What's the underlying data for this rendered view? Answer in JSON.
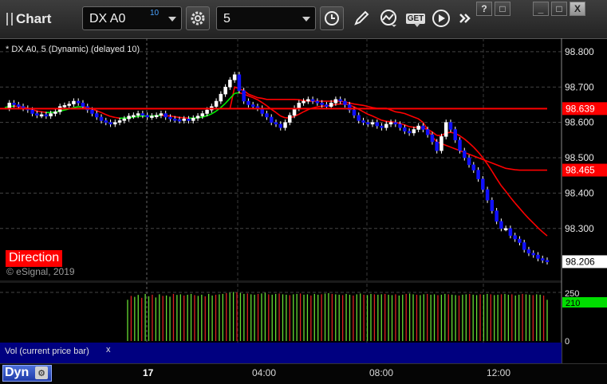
{
  "toolbar": {
    "title": "Chart",
    "symbol": "DX A0",
    "symbol_badge": "10",
    "interval": "5",
    "get_label": "GET",
    "window_buttons": [
      "?",
      "□",
      "_",
      "□",
      "X"
    ]
  },
  "chart": {
    "study_label": "* DX A0, 5 (Dynamic) (delayed 10)",
    "direction_label": "Direction",
    "copyright": "© eSignal, 2019",
    "volume_label": "Vol (current price bar)",
    "volume_close": "x",
    "dyn_label": "Dyn",
    "colors": {
      "background": "#000000",
      "candle_up": "#ffffff",
      "candle_down": "#1010ff",
      "ma_red": "#ff0000",
      "ma_green": "#00ee00",
      "vol_up": "#66dd33",
      "vol_down": "#dd2222",
      "price_marker": "#ff0000",
      "volume_marker": "#00dd00",
      "volume_panel": "#000080"
    }
  },
  "chart_data": {
    "type": "line",
    "price_axis_ticks": [
      "98.800",
      "98.700",
      "98.600",
      "98.500",
      "98.400",
      "98.300"
    ],
    "price_ylim": [
      98.18,
      98.82
    ],
    "time_ticks": [
      "17",
      "04:00",
      "08:00",
      "12:00"
    ],
    "price_markers": [
      "98.639",
      "98.465",
      "98.206"
    ],
    "volume_ticks": [
      "250",
      "0"
    ],
    "volume_marker": "210",
    "price_series": [
      98.64,
      98.655,
      98.65,
      98.645,
      98.64,
      98.635,
      98.625,
      98.62,
      98.622,
      98.618,
      98.625,
      98.63,
      98.645,
      98.648,
      98.652,
      98.66,
      98.655,
      98.645,
      98.635,
      98.625,
      98.615,
      98.605,
      98.6,
      98.595,
      98.6,
      98.605,
      98.61,
      98.618,
      98.62,
      98.625,
      98.62,
      98.615,
      98.618,
      98.62,
      98.625,
      98.615,
      98.61,
      98.608,
      98.605,
      98.61,
      98.605,
      98.612,
      98.618,
      98.625,
      98.635,
      98.645,
      98.66,
      98.68,
      98.7,
      98.72,
      98.735,
      98.69,
      98.66,
      98.65,
      98.645,
      98.64,
      98.625,
      98.615,
      98.6,
      98.595,
      98.585,
      98.6,
      98.62,
      98.64,
      98.655,
      98.66,
      98.665,
      98.66,
      98.655,
      98.65,
      98.645,
      98.655,
      98.665,
      98.66,
      98.65,
      98.635,
      98.62,
      98.605,
      98.6,
      98.595,
      98.6,
      98.59,
      98.585,
      98.595,
      98.6,
      98.595,
      98.585,
      98.575,
      98.57,
      98.58,
      98.59,
      98.58,
      98.565,
      98.545,
      98.52,
      98.56,
      98.6,
      98.58,
      98.55,
      98.52,
      98.5,
      98.48,
      98.465,
      98.44,
      98.41,
      98.38,
      98.35,
      98.32,
      98.3,
      98.3,
      98.28,
      98.27,
      98.26,
      98.24,
      98.23,
      98.225,
      98.215,
      98.21,
      98.206
    ],
    "ma_short": [
      98.642,
      98.645,
      98.646,
      98.645,
      98.643,
      98.64,
      98.636,
      98.632,
      98.63,
      98.628,
      98.628,
      98.629,
      98.632,
      98.635,
      98.638,
      98.642,
      98.644,
      98.644,
      98.642,
      98.638,
      98.633,
      98.628,
      98.622,
      98.617,
      98.614,
      98.612,
      98.612,
      98.613,
      98.615,
      98.617,
      98.618,
      98.618,
      98.618,
      98.619,
      98.62,
      98.619,
      98.618,
      98.616,
      98.614,
      98.613,
      98.612,
      98.612,
      98.613,
      98.615,
      98.619,
      98.624,
      98.632,
      98.642,
      98.654,
      98.668,
      98.682,
      98.684,
      98.68,
      98.675,
      98.67,
      98.664,
      98.656,
      98.647,
      98.637,
      98.628,
      98.618,
      98.613,
      98.613,
      98.617,
      98.623,
      98.63,
      98.636,
      98.641,
      98.644,
      98.646,
      98.646,
      98.648,
      98.651,
      98.652,
      98.652,
      98.649,
      98.644,
      98.637,
      98.63,
      98.623,
      98.618,
      98.612,
      98.606,
      98.603,
      98.602,
      98.6,
      98.597,
      98.593,
      98.588,
      98.586,
      98.586,
      98.584,
      98.58,
      98.573,
      98.563,
      98.563,
      98.57,
      98.572,
      98.569,
      98.562,
      98.553,
      98.542,
      98.53,
      98.516,
      98.5,
      98.482,
      98.462,
      98.441,
      98.421,
      98.405,
      98.388,
      98.372,
      98.357,
      98.342,
      98.328,
      98.315,
      98.302,
      98.29,
      98.279
    ],
    "ma_long": [
      98.639,
      98.639,
      98.639,
      98.639,
      98.639,
      98.639,
      98.639,
      98.639,
      98.639,
      98.639,
      98.639,
      98.639,
      98.639,
      98.639,
      98.639,
      98.639,
      98.639,
      98.639,
      98.639,
      98.639,
      98.639,
      98.639,
      98.639,
      98.639,
      98.639,
      98.639,
      98.639,
      98.639,
      98.639,
      98.639,
      98.639,
      98.639,
      98.639,
      98.639,
      98.639,
      98.639,
      98.639,
      98.639,
      98.639,
      98.639,
      98.639,
      98.639,
      98.639,
      98.639,
      98.639,
      98.639,
      98.639,
      98.639,
      98.639,
      98.639,
      98.7,
      98.695,
      98.69,
      98.68,
      98.675,
      98.67,
      98.668,
      98.665,
      98.665,
      98.665,
      98.665,
      98.665,
      98.665,
      98.665,
      98.664,
      98.662,
      98.66,
      98.66,
      98.66,
      98.66,
      98.66,
      98.66,
      98.66,
      98.66,
      98.658,
      98.655,
      98.652,
      98.65,
      98.648,
      98.645,
      98.642,
      98.64,
      98.64,
      98.64,
      98.635,
      98.63,
      98.628,
      98.625,
      98.62,
      98.615,
      98.61,
      98.6,
      98.58,
      98.56,
      98.545,
      98.54,
      98.535,
      98.53,
      98.525,
      98.52,
      98.515,
      98.51,
      98.505,
      98.5,
      98.495,
      98.49,
      98.485,
      98.48,
      98.475,
      98.47,
      98.468,
      98.466,
      98.465,
      98.465,
      98.465,
      98.465,
      98.465,
      98.465,
      98.465
    ],
    "volume": [
      210,
      230,
      225,
      235,
      220,
      240,
      228,
      236,
      222,
      238,
      230,
      232,
      226,
      240,
      235,
      238,
      232,
      236,
      240,
      234,
      230,
      236,
      228,
      240,
      232,
      236,
      238,
      240,
      244,
      246,
      250,
      248,
      245,
      240,
      242,
      238,
      236,
      240,
      242,
      246,
      238,
      236,
      240,
      242,
      238,
      236,
      234,
      238,
      240,
      242,
      236,
      238,
      232,
      240,
      236,
      238,
      242,
      244,
      240,
      238,
      236,
      234,
      240,
      236,
      232,
      238,
      242,
      236,
      234,
      240,
      238,
      236,
      238,
      240,
      236,
      234,
      238,
      232,
      236,
      240,
      242,
      238,
      236,
      234,
      238,
      240,
      236,
      238,
      234,
      236,
      240,
      238,
      236,
      234,
      232,
      236,
      238,
      240,
      236,
      234,
      238,
      236,
      240,
      238,
      234,
      236,
      238,
      240,
      236,
      238,
      232,
      236,
      240,
      238,
      236,
      234,
      238,
      236,
      232,
      210
    ]
  }
}
